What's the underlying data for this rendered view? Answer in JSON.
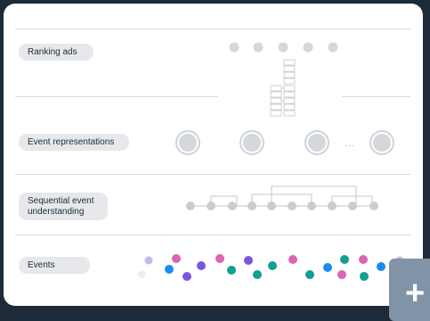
{
  "layers": [
    {
      "id": "ranking",
      "label": "Ranking ads"
    },
    {
      "id": "representations",
      "label": "Event representations"
    },
    {
      "id": "sequential",
      "label": "Sequential event\nunderstanding"
    },
    {
      "id": "events",
      "label": "Events"
    }
  ],
  "representations_ellipsis": "…",
  "colors": {
    "background": "#1d2a3a",
    "card": "#ffffff",
    "pill": "#e6e8eb",
    "node_gray": "#d4d7db",
    "teal": "#119f92",
    "pink": "#d966b0",
    "blue": "#1a8cf0",
    "purple": "#7a56e0",
    "lavender": "#c7b8f2"
  },
  "add_button": {
    "icon": "plus-icon",
    "label": "+"
  }
}
